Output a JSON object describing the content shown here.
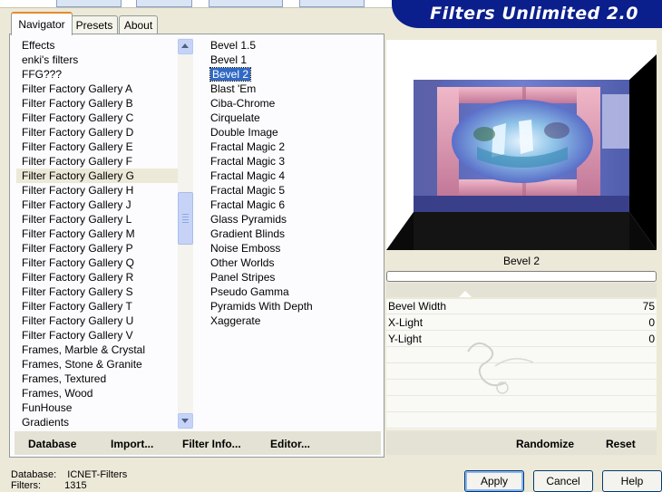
{
  "window": {
    "banner_title": "Filters Unlimited 2.0"
  },
  "tabs": [
    {
      "label": "Navigator",
      "active": true
    },
    {
      "label": "Presets"
    },
    {
      "label": "About"
    }
  ],
  "categories": {
    "items": [
      "Effects",
      "enki's filters",
      "FFG???",
      "Filter Factory Gallery A",
      "Filter Factory Gallery B",
      "Filter Factory Gallery C",
      "Filter Factory Gallery D",
      "Filter Factory Gallery E",
      "Filter Factory Gallery F",
      "Filter Factory Gallery G",
      "Filter Factory Gallery H",
      "Filter Factory Gallery J",
      "Filter Factory Gallery L",
      "Filter Factory Gallery M",
      "Filter Factory Gallery P",
      "Filter Factory Gallery Q",
      "Filter Factory Gallery R",
      "Filter Factory Gallery S",
      "Filter Factory Gallery T",
      "Filter Factory Gallery U",
      "Filter Factory Gallery V",
      "Frames, Marble & Crystal",
      "Frames, Stone & Granite",
      "Frames, Textured",
      "Frames, Wood",
      "FunHouse",
      "Gradients"
    ],
    "selected": "Filter Factory Gallery G"
  },
  "filters": {
    "items": [
      "Bevel 1.5",
      "Bevel 1",
      "Bevel 2",
      "Blast 'Em",
      "Ciba-Chrome",
      "Cirquelate",
      "Double Image",
      "Fractal Magic 2",
      "Fractal Magic 3",
      "Fractal Magic 4",
      "Fractal Magic 5",
      "Fractal Magic 6",
      "Glass Pyramids",
      "Gradient Blinds",
      "Noise Emboss",
      "Other Worlds",
      "Panel Stripes",
      "Pseudo Gamma",
      "Pyramids With Depth",
      "Xaggerate"
    ],
    "selected": "Bevel 2"
  },
  "left_actions": {
    "database": "Database",
    "import": "Import...",
    "filter_info": "Filter Info...",
    "editor": "Editor..."
  },
  "preview": {
    "caption": "Bevel 2"
  },
  "params": [
    {
      "label": "Bevel Width",
      "value": "75"
    },
    {
      "label": "X-Light",
      "value": "0"
    },
    {
      "label": "Y-Light",
      "value": "0"
    }
  ],
  "right_actions": {
    "randomize": "Randomize",
    "reset": "Reset"
  },
  "status": {
    "database_label": "Database:",
    "database_value": "ICNET-Filters",
    "filters_label": "Filters:",
    "filters_value": "1315"
  },
  "dialog_buttons": {
    "apply": "Apply",
    "cancel": "Cancel",
    "help": "Help"
  },
  "colors": {
    "banner": "#0a1e8c",
    "selection": "#316ac5",
    "tab_highlight": "#e68b2c"
  }
}
